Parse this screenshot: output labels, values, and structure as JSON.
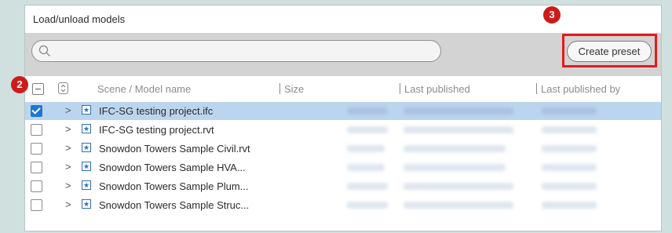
{
  "panel": {
    "title": "Load/unload models"
  },
  "search": {
    "placeholder": ""
  },
  "toolbar": {
    "create_preset_label": "Create preset"
  },
  "columns": {
    "scene": "Scene / Model name",
    "size": "Size",
    "last_published": "Last published",
    "last_published_by": "Last published by"
  },
  "rows": [
    {
      "name": "IFC-SG testing project.ifc",
      "checked": true,
      "selected": true
    },
    {
      "name": "IFC-SG testing project.rvt",
      "checked": false,
      "selected": false
    },
    {
      "name": "Snowdon Towers Sample Civil.rvt",
      "checked": false,
      "selected": false
    },
    {
      "name": "Snowdon Towers Sample HVA...",
      "checked": false,
      "selected": false
    },
    {
      "name": "Snowdon Towers Sample Plum...",
      "checked": false,
      "selected": false
    },
    {
      "name": "Snowdon Towers Sample Struc...",
      "checked": false,
      "selected": false
    }
  ],
  "callouts": {
    "c2": "2",
    "c3": "3"
  },
  "colors": {
    "accent": "#1f76d2",
    "selected_row": "#bcd5ef",
    "callout": "#cf1a1a"
  }
}
